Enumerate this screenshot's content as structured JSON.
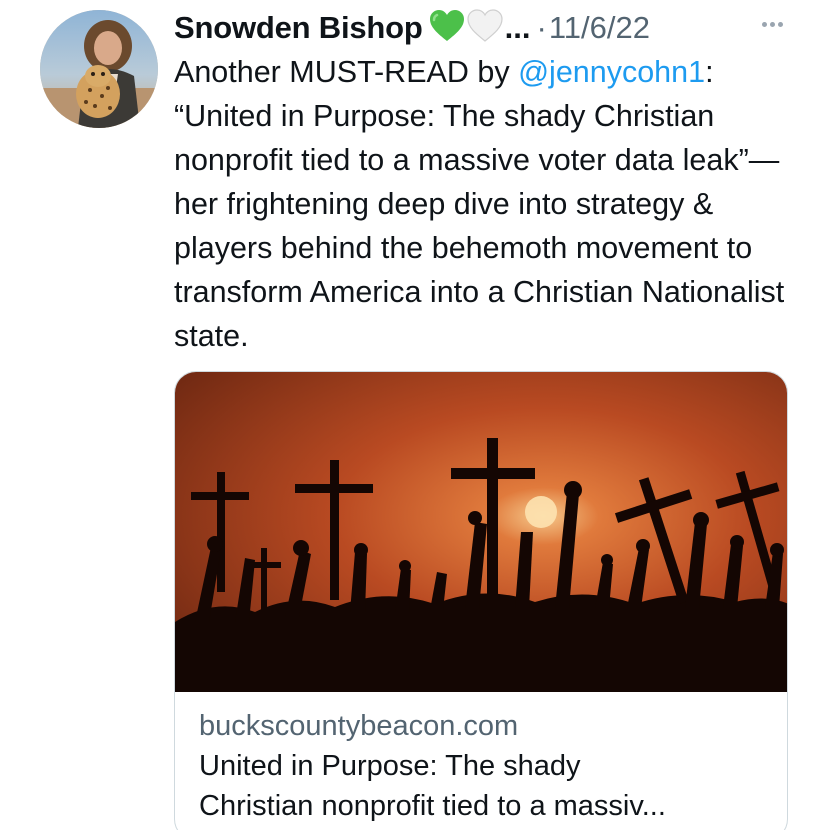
{
  "tweet": {
    "author_name": "Snowden Bishop",
    "emojis": [
      "green-heart",
      "white-heart"
    ],
    "name_ellipsis": "...",
    "separator": "·",
    "timestamp": "11/6/22",
    "text_before_mention": "Another MUST-READ by ",
    "mention": "@jennycohn1",
    "text_after_mention": ": “United in Purpose: The shady Christian nonprofit tied to a massive voter data leak”—her frightening deep dive into strategy & players behind the behemoth movement to transform America into a Christian Nationalist state."
  },
  "card": {
    "domain": "buckscountybeacon.com",
    "title_line1": "United in Purpose: The shady",
    "title_line2": "Christian nonprofit tied to a massiv..."
  },
  "colors": {
    "link": "#1d9bf0",
    "secondary_text": "#536471",
    "primary_text": "#0f1419",
    "green_heart": "#4cc04a",
    "white_heart": "#f2f2f2"
  }
}
